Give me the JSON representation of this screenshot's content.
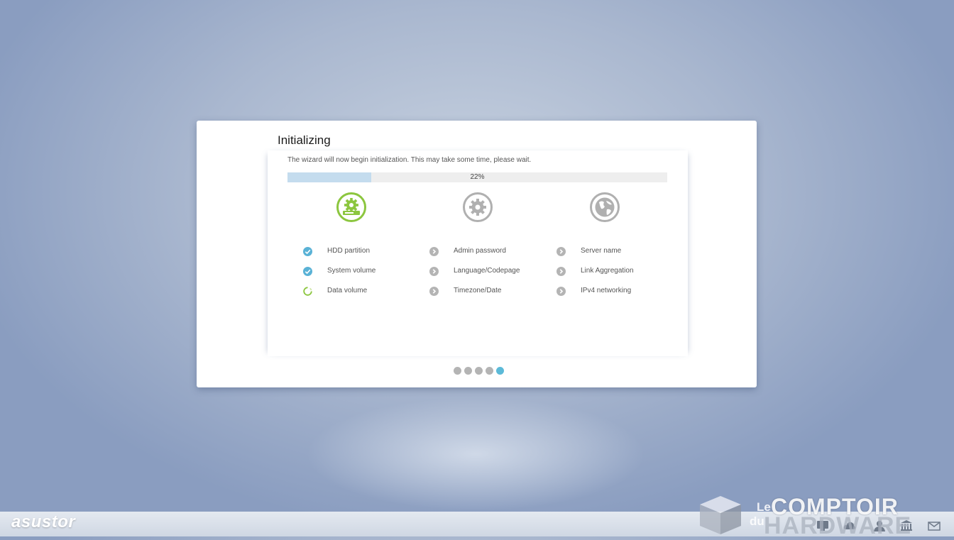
{
  "dialog": {
    "title": "Initializing",
    "description": "The wizard will now begin initialization. This may take some time, please wait.",
    "progress": {
      "percent": 22,
      "label": "22%"
    },
    "columns": [
      {
        "icon": "hdd-gear-icon",
        "icon_color": "#8cc63f",
        "items": [
          {
            "label": "HDD partition",
            "status": "done",
            "status_icon": "check-circle-icon"
          },
          {
            "label": "System volume",
            "status": "done",
            "status_icon": "check-circle-icon"
          },
          {
            "label": "Data volume",
            "status": "in-progress",
            "status_icon": "spinner-icon"
          }
        ]
      },
      {
        "icon": "gear-icon",
        "icon_color": "#b0b0b0",
        "items": [
          {
            "label": "Admin password",
            "status": "pending",
            "status_icon": "chevron-circle-icon"
          },
          {
            "label": "Language/Codepage",
            "status": "pending",
            "status_icon": "chevron-circle-icon"
          },
          {
            "label": "Timezone/Date",
            "status": "pending",
            "status_icon": "chevron-circle-icon"
          }
        ]
      },
      {
        "icon": "globe-icon",
        "icon_color": "#b0b0b0",
        "items": [
          {
            "label": "Server name",
            "status": "pending",
            "status_icon": "chevron-circle-icon"
          },
          {
            "label": "Link Aggregation",
            "status": "pending",
            "status_icon": "chevron-circle-icon"
          },
          {
            "label": "IPv4 networking",
            "status": "pending",
            "status_icon": "chevron-circle-icon"
          }
        ]
      }
    ],
    "pager": {
      "total": 5,
      "active_index": 4
    }
  },
  "colors": {
    "check": "#5ab2d6",
    "pending": "#b4b4b4",
    "spinner": "#8cc63f",
    "progress_fill": "#c4dcee",
    "pager_active": "#5cbad8"
  },
  "taskbar": {
    "logo": "asustor",
    "tray_icons": [
      "display-icon",
      "cloud-icon",
      "user-icon",
      "bank-icon",
      "mail-icon"
    ]
  },
  "watermark": {
    "line1_prefix": "Le",
    "line1": "COMPTOIR",
    "line2_prefix": "du",
    "line2": "HARDWARE"
  }
}
